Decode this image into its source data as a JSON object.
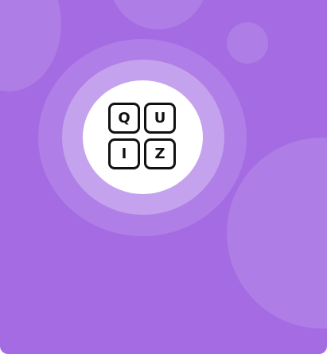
{
  "quiz_logo": {
    "letters": [
      "Q",
      "U",
      "I",
      "Z"
    ]
  },
  "colors": {
    "background": "#A46BE3",
    "tile_border": "#111111",
    "tile_fill": "#FFFFFF"
  },
  "icons": {
    "logo": "quiz-letter-tiles-icon"
  }
}
